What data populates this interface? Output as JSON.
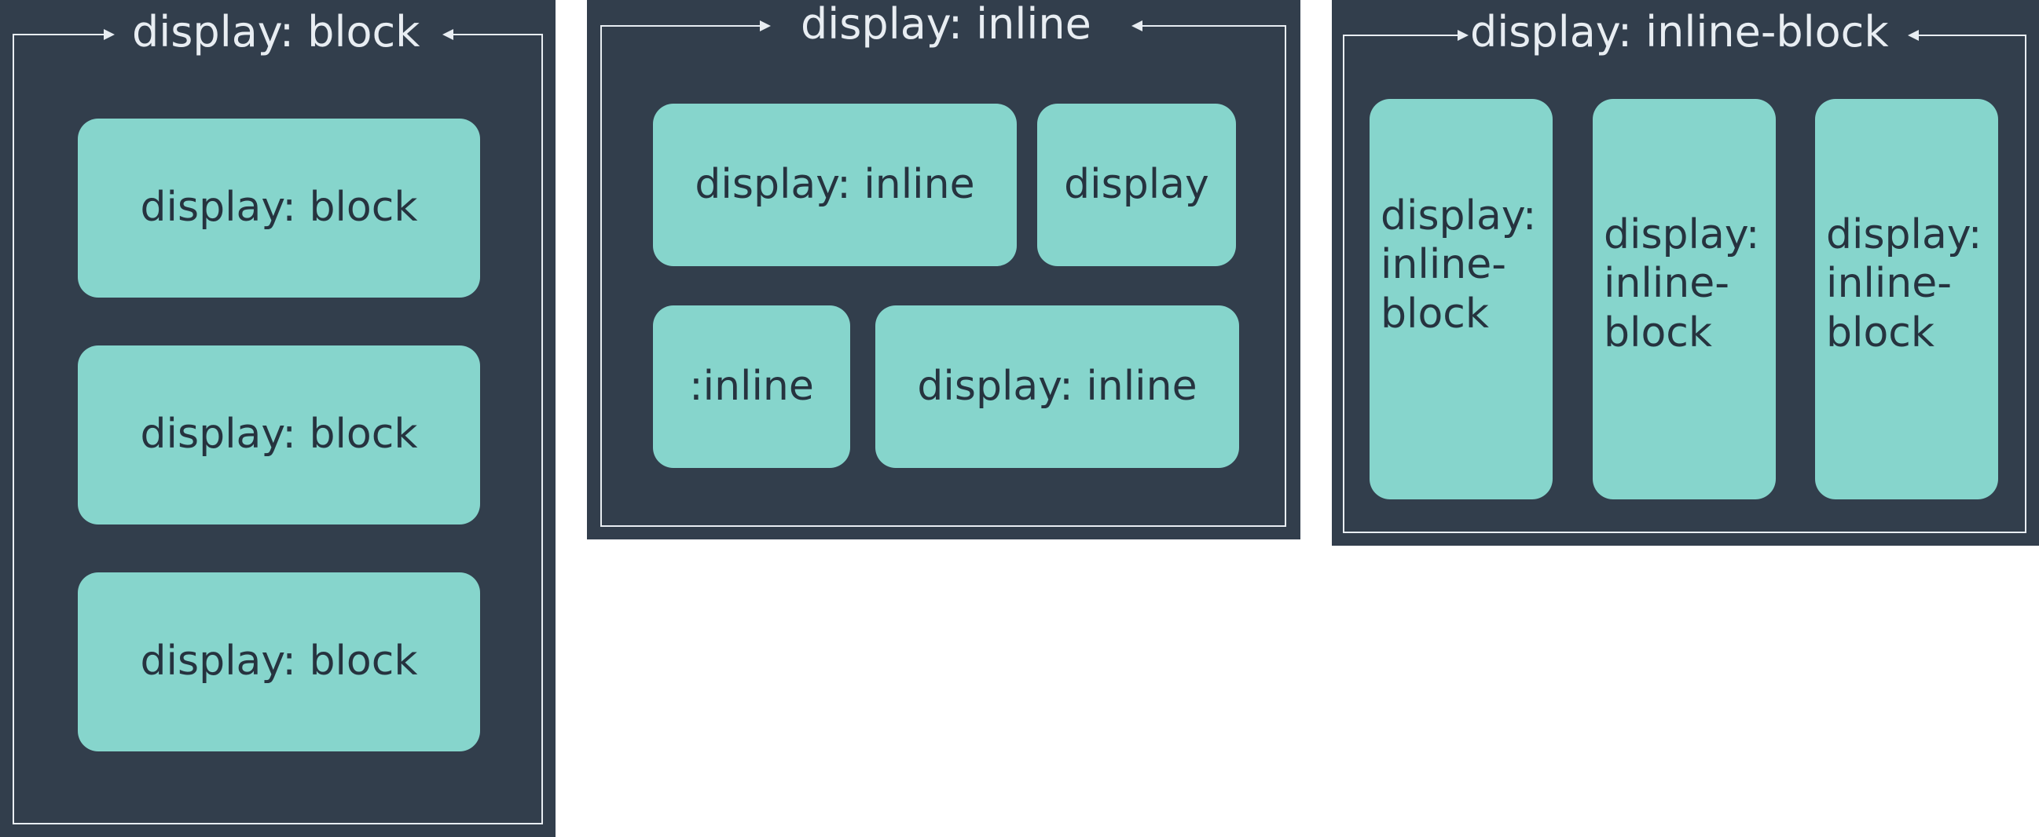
{
  "panels": [
    {
      "title": "display: block",
      "boxes": [
        "display: block",
        "display: block",
        "display: block"
      ]
    },
    {
      "title": "display: inline",
      "boxes": [
        "display: inline",
        "display",
        ":inline",
        "display: inline"
      ]
    },
    {
      "title": "display: inline-block",
      "boxes": [
        "display:\ninline-\nblock",
        "display:\ninline-\nblock",
        "display:\ninline-\nblock"
      ]
    }
  ],
  "colors": {
    "panel_bg": "#323e4c",
    "box_bg": "#86d5cc",
    "box_text": "#26333f",
    "frame_line": "#e8edf2"
  }
}
